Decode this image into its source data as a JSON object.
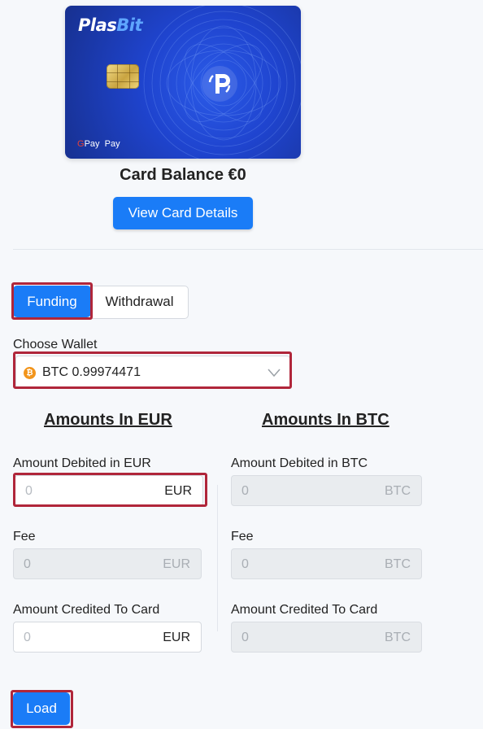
{
  "card": {
    "brand_part1": "Plas",
    "brand_part2": "Bit",
    "payments": "G Pay  Pay",
    "balance_label": "Card Balance €0",
    "view_details_label": "View Card Details"
  },
  "tabs": [
    {
      "label": "Funding",
      "active": true
    },
    {
      "label": "Withdrawal",
      "active": false
    }
  ],
  "wallet": {
    "label": "Choose Wallet",
    "selected": "BTC 0.99974471",
    "coin_symbol": "₿"
  },
  "eur_column": {
    "heading": "Amounts In EUR",
    "debited_label": "Amount Debited in EUR",
    "debited_placeholder": "0",
    "debited_unit": "EUR",
    "fee_label": "Fee",
    "fee_value": "0",
    "fee_unit": "EUR",
    "credited_label": "Amount Credited To Card",
    "credited_placeholder": "0",
    "credited_unit": "EUR"
  },
  "btc_column": {
    "heading": "Amounts In BTC",
    "debited_label": "Amount Debited in BTC",
    "debited_value": "0",
    "debited_unit": "BTC",
    "fee_label": "Fee",
    "fee_value": "0",
    "fee_unit": "BTC",
    "credited_label": "Amount Credited To Card",
    "credited_value": "0",
    "credited_unit": "BTC"
  },
  "load_label": "Load",
  "colors": {
    "primary": "#1a7cf7",
    "highlight": "#b0263a",
    "card_blue": "#1f44cf",
    "bitcoin": "#f2951c"
  }
}
